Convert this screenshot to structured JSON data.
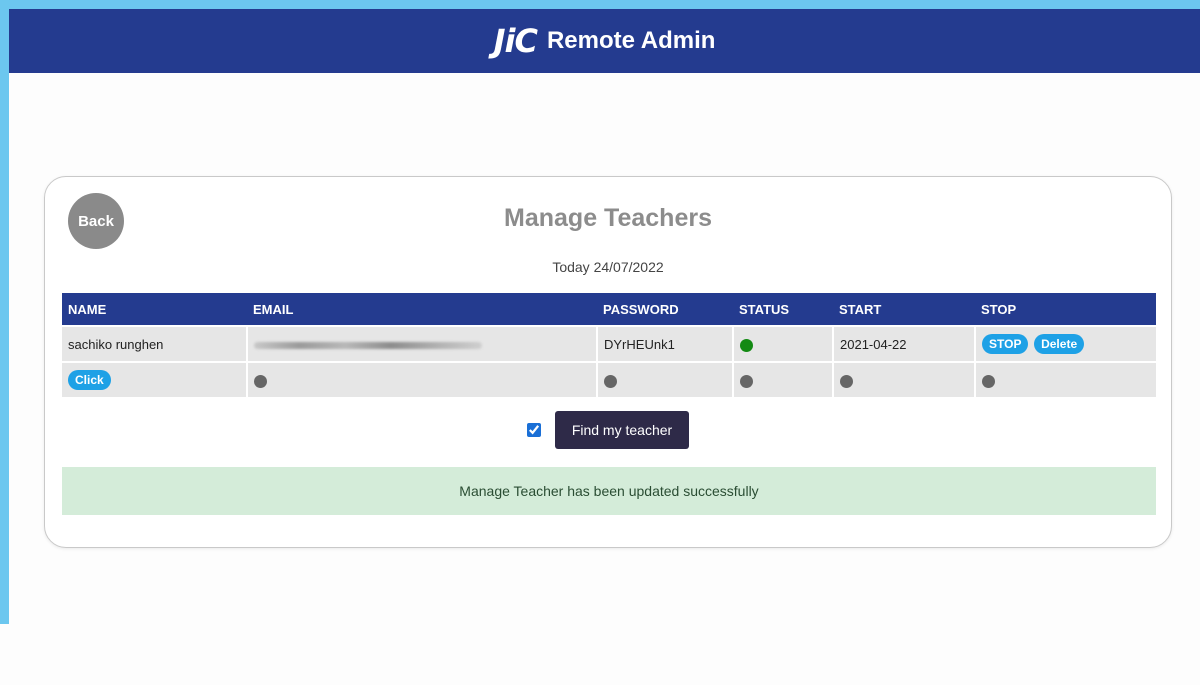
{
  "header": {
    "logo_text": "JiC",
    "title": "Remote Admin"
  },
  "card": {
    "back_label": "Back",
    "title": "Manage Teachers",
    "today": "Today 24/07/2022"
  },
  "table": {
    "columns": [
      "NAME",
      "EMAIL",
      "PASSWORD",
      "STATUS",
      "START",
      "STOP"
    ],
    "rows": [
      {
        "name": "sachiko runghen",
        "password": "DYrHEUnk1",
        "start": "2021-04-22",
        "stop_label": "STOP",
        "delete_label": "Delete"
      },
      {
        "click_label": "Click"
      }
    ]
  },
  "controls": {
    "checkbox_checked": true,
    "find_label": "Find my teacher"
  },
  "alert": {
    "message": "Manage Teacher has been updated successfully"
  },
  "colors": {
    "header": "#243b8f",
    "accent": "#1ea1e6",
    "status_active": "#138a13",
    "alert_bg": "#d4ecd9"
  }
}
